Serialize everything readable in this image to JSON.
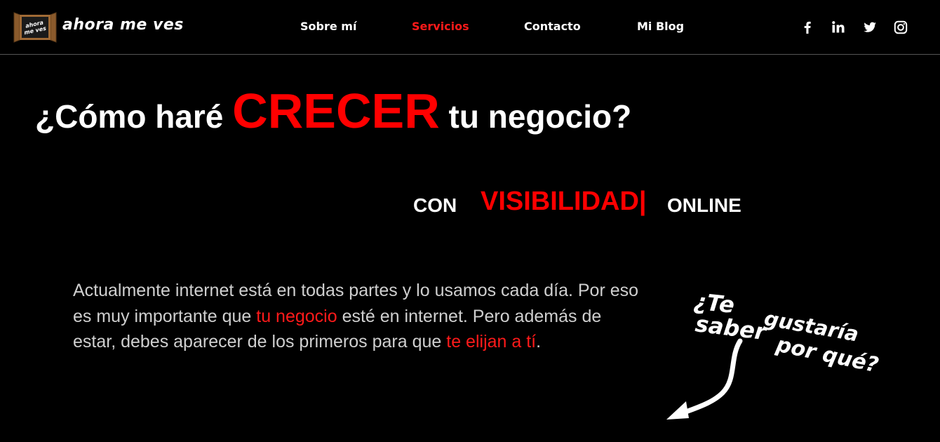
{
  "header": {
    "logo_text": "ahora me ves",
    "logo_badge_line1": "ahora",
    "logo_badge_line2": "me ves",
    "nav": [
      {
        "label": "Sobre mí"
      },
      {
        "label": "Servicios",
        "active": true
      },
      {
        "label": "Contacto"
      },
      {
        "label": "Mi Blog"
      }
    ],
    "social_icons": [
      "facebook-icon",
      "linkedin-icon",
      "twitter-icon",
      "instagram-icon"
    ]
  },
  "hero": {
    "title_pre": "¿Cómo haré ",
    "title_big": "CRECER",
    "title_post": " tu negocio?"
  },
  "typing": {
    "prefix": "CON",
    "word": "VISIBILIDAD|",
    "suffix": "ONLINE"
  },
  "intro": {
    "part1": "Actualmente internet está en todas partes y lo usamos cada día. Por eso es muy importante que ",
    "highlight1": "tu negocio",
    "part2": " esté en internet. Pero además de estar, debes aparecer de los primeros para que ",
    "highlight2": "te elijan a tí",
    "part3": "."
  },
  "callout": {
    "line1": "¿Te",
    "line2": "gustaría",
    "line3": "saber",
    "line4": "por qué?"
  },
  "colors": {
    "background": "#000000",
    "accent": "#ff0000",
    "text": "#ffffff",
    "body_text": "#cfcfcf",
    "divider": "#555555"
  }
}
